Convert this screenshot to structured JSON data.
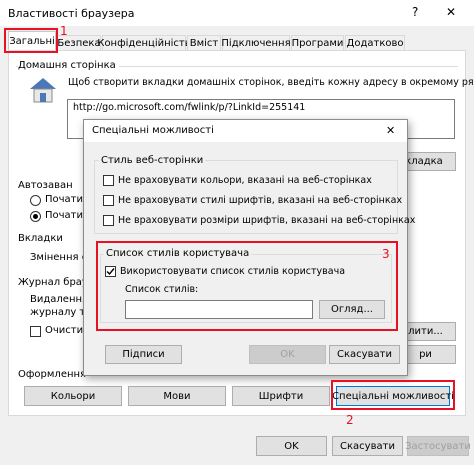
{
  "window": {
    "title": "Властивості браузера"
  },
  "title_buttons": {
    "help": "?",
    "close": "✕"
  },
  "tabs": [
    {
      "label": "Загальні"
    },
    {
      "label": "Безпека"
    },
    {
      "label": "Конфіденційність"
    },
    {
      "label": "Вміст"
    },
    {
      "label": "Підключення"
    },
    {
      "label": "Програми"
    },
    {
      "label": "Додатково"
    }
  ],
  "home_page": {
    "heading": "Домашня сторінка",
    "description": "Щоб створити вкладки домашніх сторінок, введіть кожну адресу в окремому рядку.",
    "url": "http://go.microsoft.com/fwlink/p/?LinkId=255141",
    "default_button": "кладка"
  },
  "startup": {
    "heading": "Автозаван",
    "option1": "Почати з",
    "option2": "Почати з"
  },
  "tabs_group": {
    "heading": "Вкладки",
    "text": "Змінення спо"
  },
  "history": {
    "heading": "Журнал браузе",
    "text1": "Видалення те",
    "text2": "журналу та",
    "clear_label": "Очистит",
    "delete_button": "лити...",
    "settings_button": "ри"
  },
  "appearance": {
    "heading": "Оформлення",
    "colors": "Кольори",
    "languages": "Мови",
    "fonts": "Шрифти",
    "accessibility": "Спеціальні можливості"
  },
  "footer": {
    "ok": "OK",
    "cancel": "Скасувати",
    "apply": "Застосувати"
  },
  "dialog": {
    "title": "Спеціальні можливості",
    "close": "✕",
    "style_group": "Стиль веб-сторінки",
    "ignore_colors": "Не враховувати кольори, вказані на веб-сторінках",
    "ignore_font_styles": "Не враховувати стилі шрифтів, вказані на веб-сторінках",
    "ignore_font_sizes": "Не враховувати розміри шрифтів, вказані на веб-сторінках",
    "user_style_group": "Список стилів користувача",
    "use_style_sheet": "Використовувати список стилів користувача",
    "style_sheet_label": "Список стилів:",
    "style_sheet_value": "",
    "browse": "Огляд...",
    "captions": "Підписи",
    "ok": "OK",
    "cancel": "Скасувати"
  },
  "annotations": {
    "one": "1",
    "two": "2",
    "three": "3"
  },
  "colors": {
    "annotation": "#e81123",
    "accent": "#0078d7"
  }
}
